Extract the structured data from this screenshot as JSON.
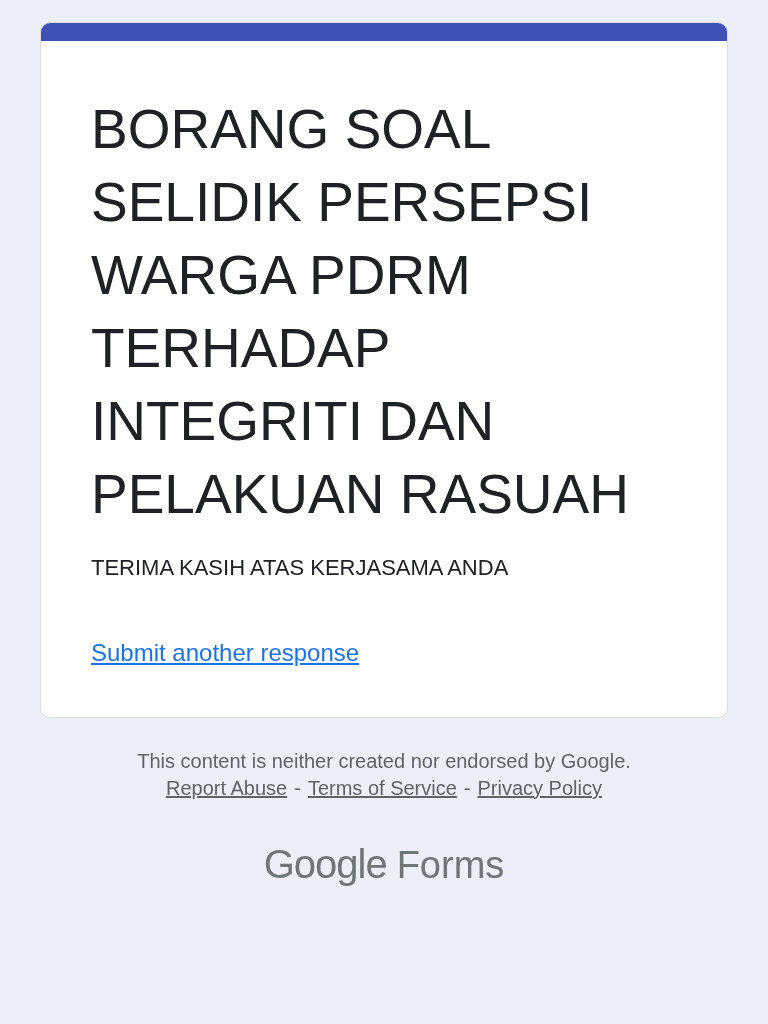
{
  "form": {
    "title": "BORANG SOAL SELIDIK PERSEPSI WARGA PDRM TERHADAP INTEGRITI DAN PELAKUAN RASUAH",
    "message": "TERIMA KASIH ATAS KERJASAMA ANDA",
    "link": "Submit another response"
  },
  "footer": {
    "disclaimer": "This content is neither created nor endorsed by Google.",
    "links": [
      "Report Abuse",
      "Terms of Service",
      "Privacy Policy"
    ],
    "separator": "-",
    "logo": {
      "brand": "Google",
      "product": "Forms"
    }
  }
}
